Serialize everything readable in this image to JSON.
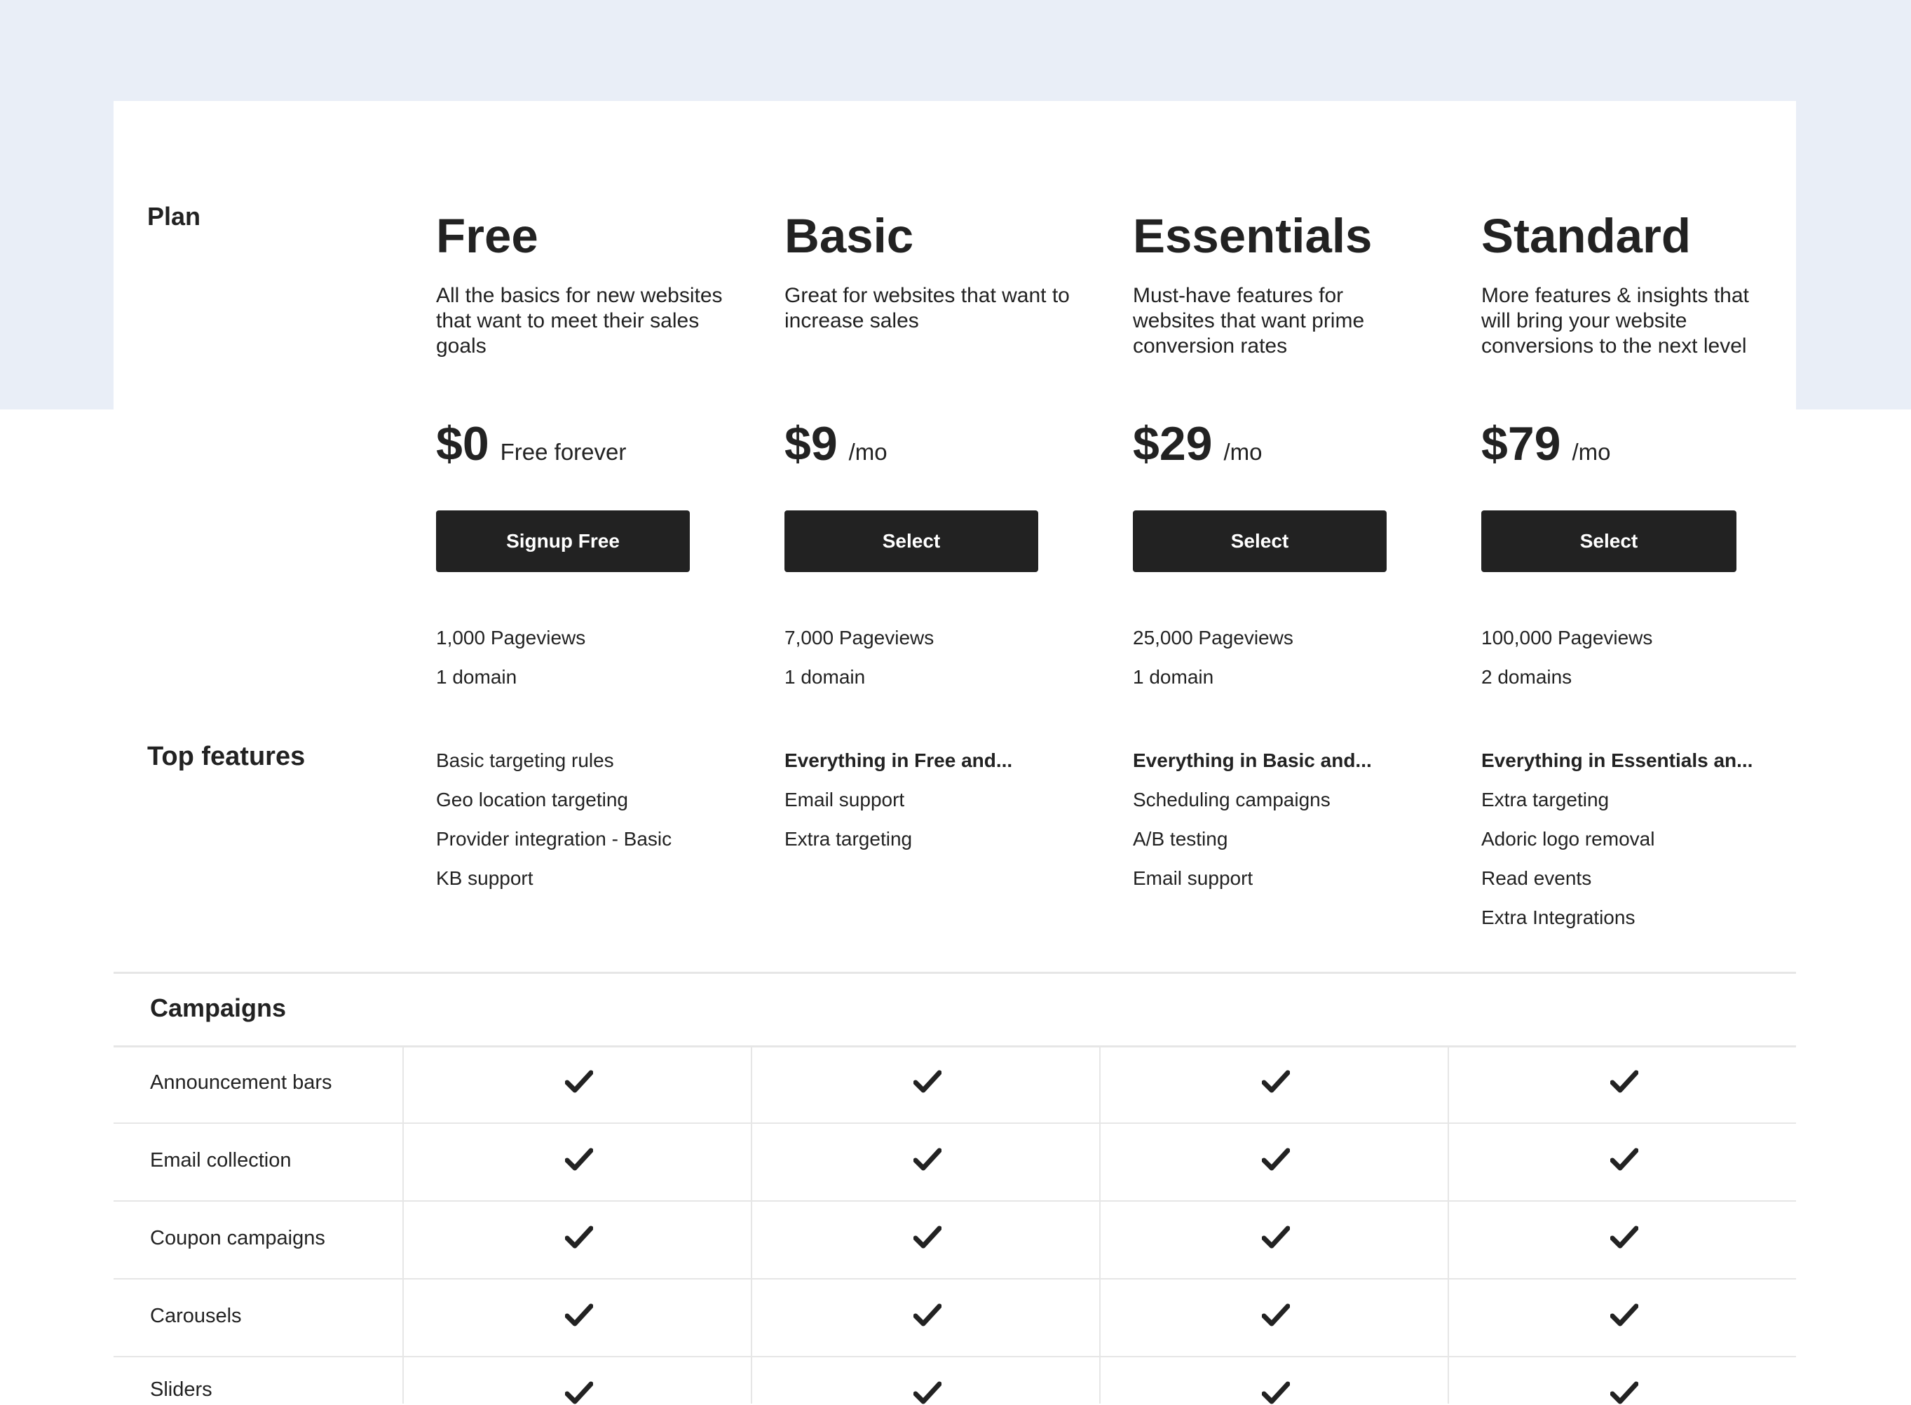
{
  "labels": {
    "plan": "Plan",
    "top_features": "Top features"
  },
  "plans": [
    {
      "name": "Free",
      "description": "All the basics for new websites that want to meet their sales goals",
      "price": "$0",
      "price_unit": "Free forever",
      "cta": "Signup Free",
      "stats": [
        "1,000 Pageviews",
        "1 domain"
      ],
      "features": [
        "Basic targeting rules",
        "Geo location targeting",
        "Provider integration - Basic",
        "KB support"
      ]
    },
    {
      "name": "Basic",
      "description": "Great for websites that want to increase sales",
      "price": "$9",
      "price_unit": "/mo",
      "cta": "Select",
      "stats": [
        "7,000 Pageviews",
        "1 domain"
      ],
      "features": [
        "Everything in Free and...",
        "Email support",
        "Extra targeting"
      ]
    },
    {
      "name": "Essentials",
      "description": "Must-have features for websites that want prime conversion rates",
      "price": "$29",
      "price_unit": "/mo",
      "cta": "Select",
      "stats": [
        "25,000 Pageviews",
        "1 domain"
      ],
      "features": [
        "Everything in Basic and...",
        "Scheduling campaigns",
        "A/B testing",
        "Email support"
      ]
    },
    {
      "name": "Standard",
      "description": "More features & insights that will bring your website conversions to the next level",
      "price": "$79",
      "price_unit": "/mo",
      "cta": "Select",
      "stats": [
        "100,000 Pageviews",
        "2 domains"
      ],
      "features": [
        "Everything in Essentials an...",
        "Extra targeting",
        "Adoric logo removal",
        "Read events",
        "Extra Integrations"
      ]
    }
  ],
  "comparison": {
    "section_title": "Campaigns",
    "rows": [
      {
        "label": "Announcement bars",
        "included": [
          true,
          true,
          true,
          true
        ]
      },
      {
        "label": "Email collection",
        "included": [
          true,
          true,
          true,
          true
        ]
      },
      {
        "label": "Coupon campaigns",
        "included": [
          true,
          true,
          true,
          true
        ]
      },
      {
        "label": "Carousels",
        "included": [
          true,
          true,
          true,
          true
        ]
      },
      {
        "label": "Sliders",
        "included": [
          true,
          true,
          true,
          true
        ]
      }
    ]
  },
  "colors": {
    "band": "#e9eef7",
    "card": "#ffffff",
    "text": "#222222",
    "button_bg": "#222222",
    "button_text": "#ffffff",
    "divider": "#e6e6e6"
  },
  "icons": {
    "check": "check-icon"
  }
}
